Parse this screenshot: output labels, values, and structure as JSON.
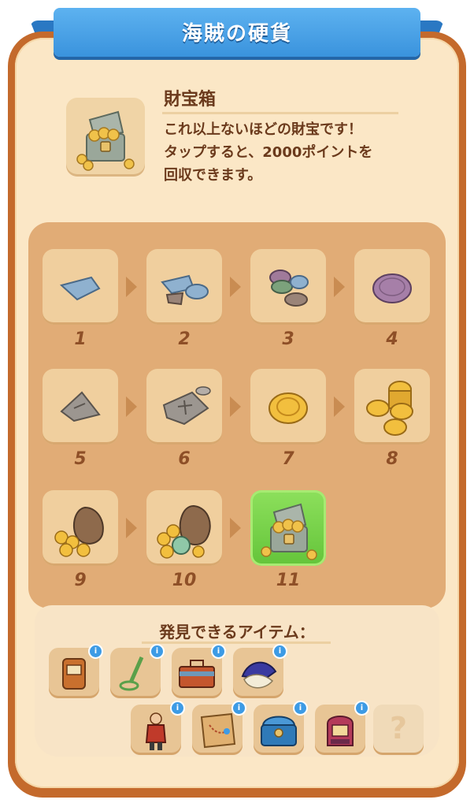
{
  "header": {
    "title": "海賊の硬貨"
  },
  "item": {
    "name": "財宝箱",
    "description_line1": "これ以上ないほどの財宝です！",
    "description_line2": "タップすると、2000ポイントを",
    "description_line3": "回収できます。"
  },
  "merge_chain": [
    {
      "level": "1",
      "icon": "coin-fragment-icon"
    },
    {
      "level": "2",
      "icon": "coin-fragments-icon"
    },
    {
      "level": "3",
      "icon": "stacked-coins-icon"
    },
    {
      "level": "4",
      "icon": "purple-coin-icon"
    },
    {
      "level": "5",
      "icon": "stone-shard-icon"
    },
    {
      "level": "6",
      "icon": "stone-slab-icon"
    },
    {
      "level": "7",
      "icon": "gold-coin-icon"
    },
    {
      "level": "8",
      "icon": "gold-coin-stack-icon"
    },
    {
      "level": "9",
      "icon": "coin-sack-icon"
    },
    {
      "level": "10",
      "icon": "large-coin-sack-icon"
    },
    {
      "level": "11",
      "icon": "treasure-chest-icon",
      "selected": true
    }
  ],
  "discoverable": {
    "title": "発見できるアイテム：",
    "items": [
      {
        "icon": "slot-machine-icon"
      },
      {
        "icon": "metal-detector-icon"
      },
      {
        "icon": "toolbox-icon"
      },
      {
        "icon": "pirate-hat-icon"
      },
      {
        "icon": "pirate-captain-icon"
      },
      {
        "icon": "treasure-map-icon"
      },
      {
        "icon": "blue-chest-icon"
      },
      {
        "icon": "jukebox-icon"
      },
      {
        "icon": "unknown-item-icon"
      }
    ],
    "unknown_label": "?"
  },
  "colors": {
    "accent_blue": "#3a93dd",
    "panel_border": "#c46a2c",
    "panel_bg": "#fbe7c6",
    "selected_green": "#64c43a",
    "text_brown": "#6b3a1c"
  }
}
